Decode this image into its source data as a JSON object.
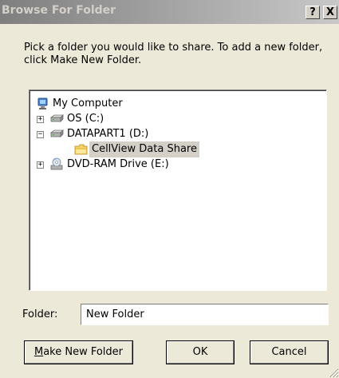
{
  "window": {
    "title": "Browse For Folder",
    "help_label": "?",
    "close_label": "X"
  },
  "instructions": "Pick a folder you would like to share. To add a new folder, click Make New Folder.",
  "tree": {
    "items": [
      {
        "label": "My Computer",
        "icon": "my-computer-icon",
        "expander": ""
      },
      {
        "label": "OS (C:)",
        "icon": "hard-drive-icon",
        "expander": "+"
      },
      {
        "label": "DATAPART1 (D:)",
        "icon": "hard-drive-icon",
        "expander": "−"
      },
      {
        "label": "CellView Data Share",
        "icon": "folder-icon",
        "expander": "",
        "selected": true
      },
      {
        "label": "DVD-RAM Drive (E:)",
        "icon": "dvd-drive-icon",
        "expander": "+"
      }
    ]
  },
  "folder_field": {
    "label": "Folder:",
    "value": "New Folder"
  },
  "buttons": {
    "make_new_folder_mnemonic": "M",
    "make_new_folder_rest": "ake New Folder",
    "ok": "OK",
    "cancel": "Cancel"
  }
}
